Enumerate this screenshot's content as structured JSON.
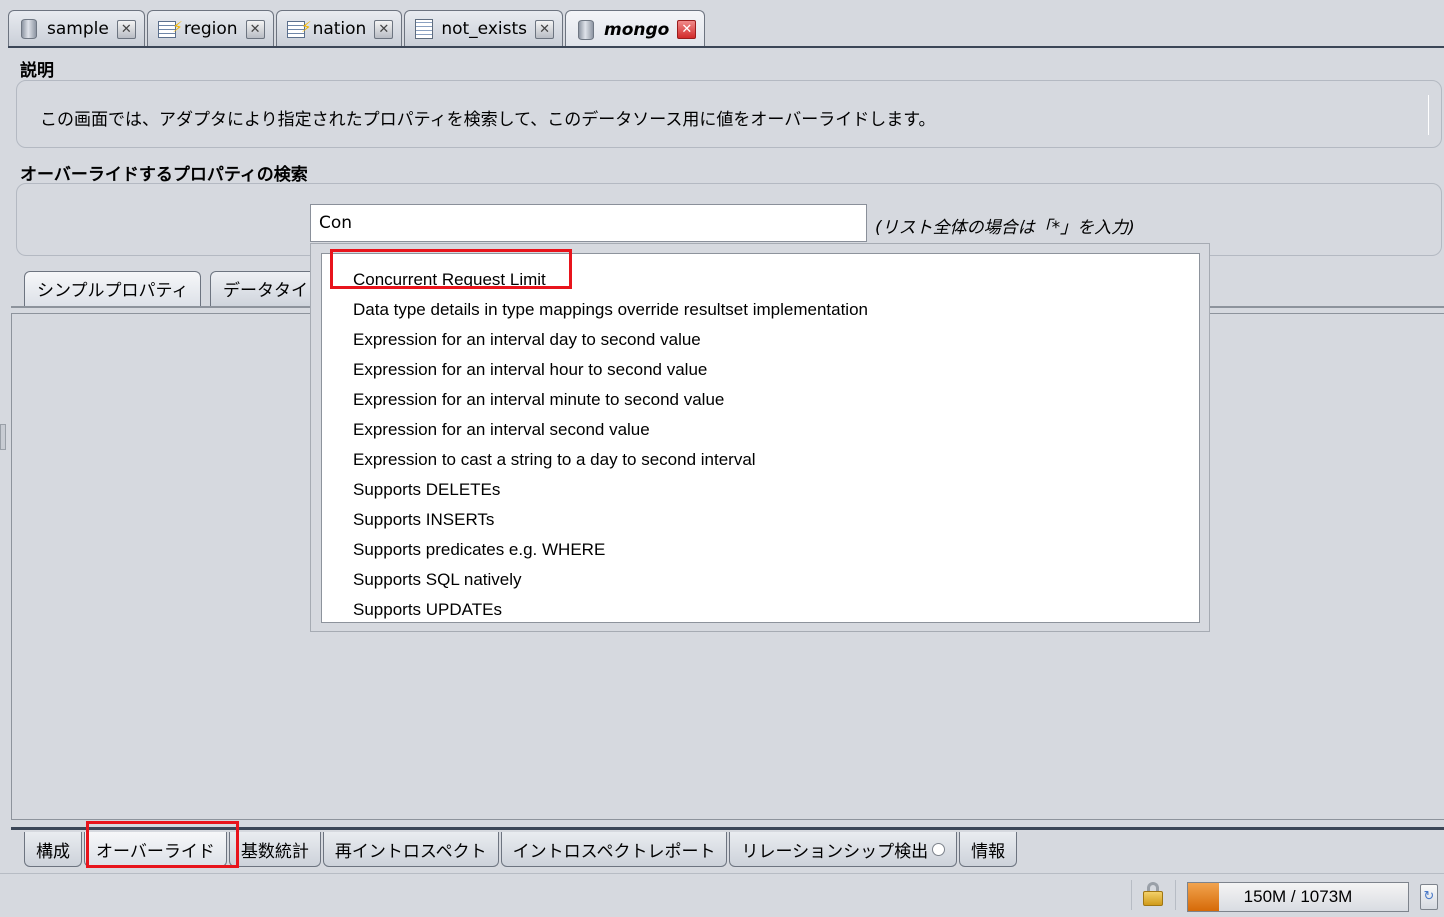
{
  "top_tabs": [
    {
      "label": "sample",
      "icon": "database-icon",
      "active": false
    },
    {
      "label": "region",
      "icon": "table-lightning-icon",
      "active": false
    },
    {
      "label": "nation",
      "icon": "table-lightning-icon",
      "active": false
    },
    {
      "label": "not_exists",
      "icon": "document-table-icon",
      "active": false
    },
    {
      "label": "mongo",
      "icon": "database-icon",
      "active": true
    }
  ],
  "description": {
    "title": "説明",
    "text": "この画面では、アダプタにより指定されたプロパティを検索して、このデータソース用に値をオーバーライドします。"
  },
  "search": {
    "title": "オーバーライドするプロパティの検索",
    "value": "Con",
    "hint": "(リスト全体の場合は「*」を入力)"
  },
  "sub_tabs": [
    "シンプルプロパティ",
    "データタイ"
  ],
  "dropdown": {
    "items": [
      "Concurrent Request Limit",
      "Data type details in type mappings override resultset implementation",
      "Expression for an interval day to second value",
      "Expression for an interval hour to second value",
      "Expression for an interval minute to second value",
      "Expression for an interval second value",
      "Expression to cast a string to a day to second interval",
      "Supports DELETEs",
      "Supports INSERTs",
      "Supports predicates e.g. WHERE",
      "Supports SQL natively",
      "Supports UPDATEs"
    ],
    "highlighted_index": 0
  },
  "bottom_tabs": [
    {
      "label": "構成",
      "active": false
    },
    {
      "label": "オーバーライド",
      "active": true
    },
    {
      "label": "基数統計",
      "active": false
    },
    {
      "label": "再イントロスペクト",
      "active": false
    },
    {
      "label": "イントロスペクトレポート",
      "active": false
    },
    {
      "label": "リレーションシップ検出",
      "active": false,
      "indicator": true
    },
    {
      "label": "情報",
      "active": false
    }
  ],
  "status": {
    "memory": "150M / 1073M",
    "memory_used_fraction": 0.14,
    "highlight_color": "#e8141c"
  }
}
